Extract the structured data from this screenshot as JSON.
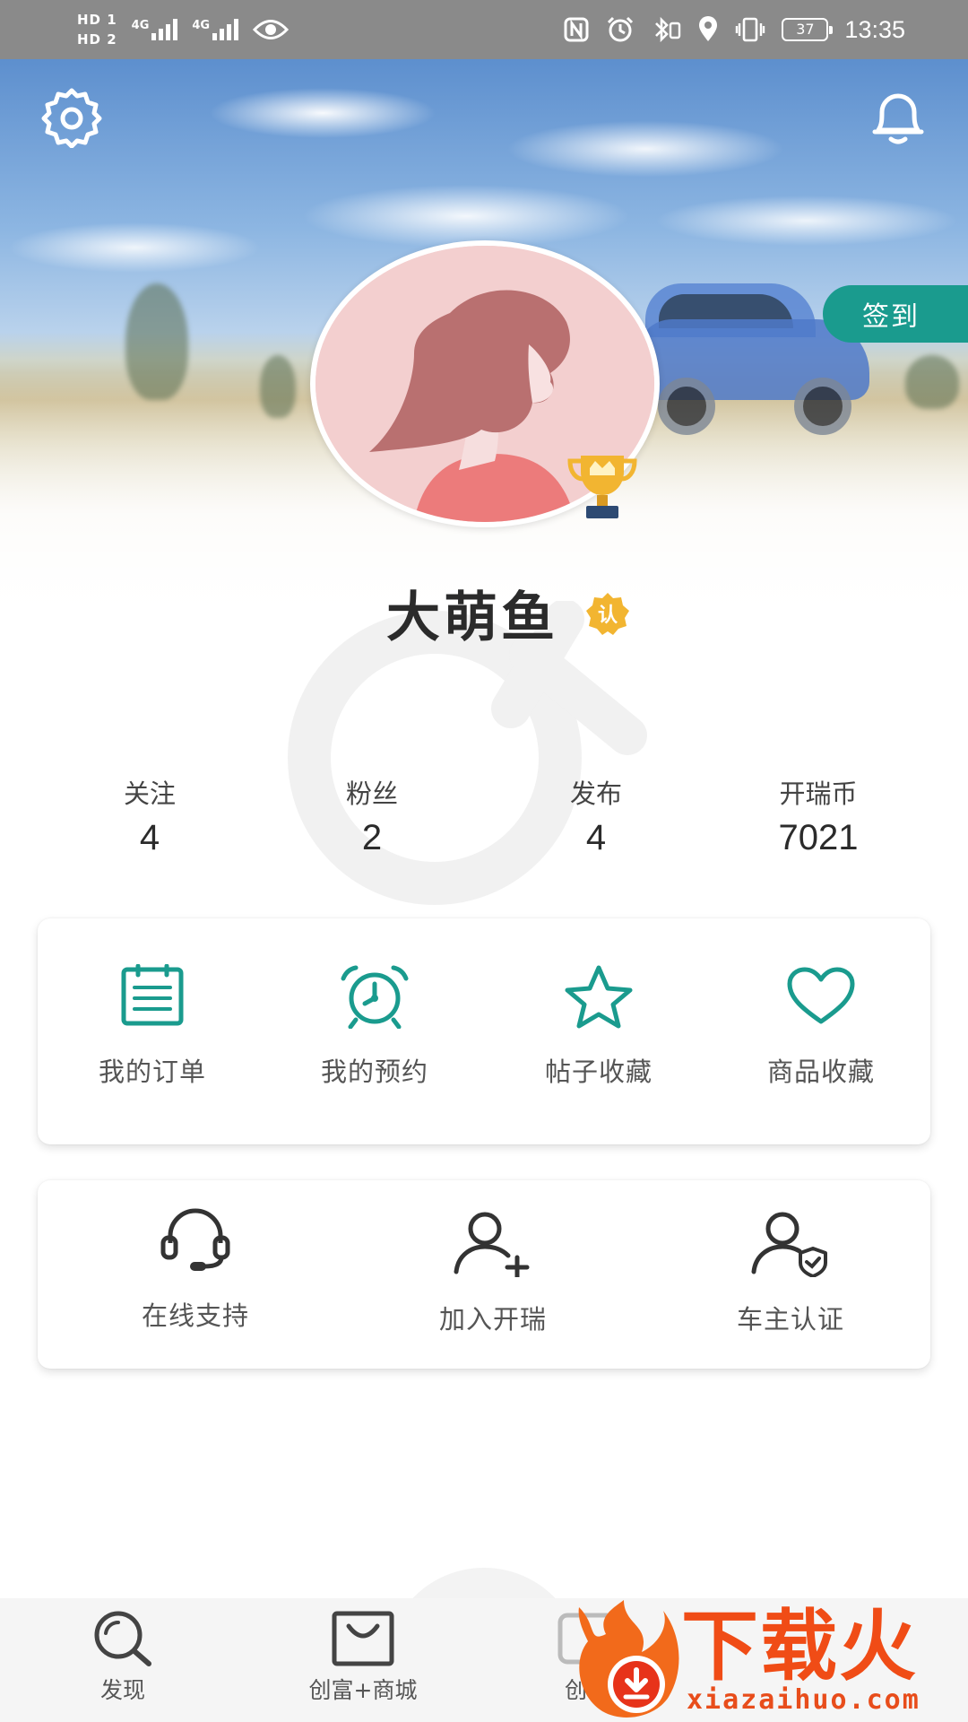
{
  "status_bar": {
    "hd1": "HD 1",
    "hd2": "HD 2",
    "net1": "4G",
    "net2": "4G",
    "battery": "37",
    "time": "13:35"
  },
  "header": {
    "settings_icon": "gear-icon",
    "notification_icon": "bell-icon",
    "checkin_label": "签到"
  },
  "profile": {
    "username": "大萌鱼",
    "verify_badge": "认",
    "accent_color": "#1a9b8e"
  },
  "stats": [
    {
      "label": "关注",
      "value": "4"
    },
    {
      "label": "粉丝",
      "value": "2"
    },
    {
      "label": "发布",
      "value": "4"
    },
    {
      "label": "开瑞币",
      "value": "7021"
    }
  ],
  "quick_actions": [
    {
      "label": "我的订单",
      "icon": "clipboard-icon"
    },
    {
      "label": "我的预约",
      "icon": "alarm-clock-icon"
    },
    {
      "label": "帖子收藏",
      "icon": "star-icon"
    },
    {
      "label": "商品收藏",
      "icon": "heart-icon"
    }
  ],
  "services": [
    {
      "label": "在线支持",
      "icon": "headset-icon"
    },
    {
      "label": "加入开瑞",
      "icon": "add-user-icon"
    },
    {
      "label": "车主认证",
      "icon": "verified-user-icon"
    }
  ],
  "bottom_nav": [
    {
      "label": "发现",
      "icon": "search-icon"
    },
    {
      "label": "创富+商城",
      "icon": "shopping-bag-icon"
    },
    {
      "label": "创富",
      "icon": "tab-icon"
    }
  ],
  "watermark": {
    "title": "下载火",
    "url": "xiazaihuo.com"
  }
}
